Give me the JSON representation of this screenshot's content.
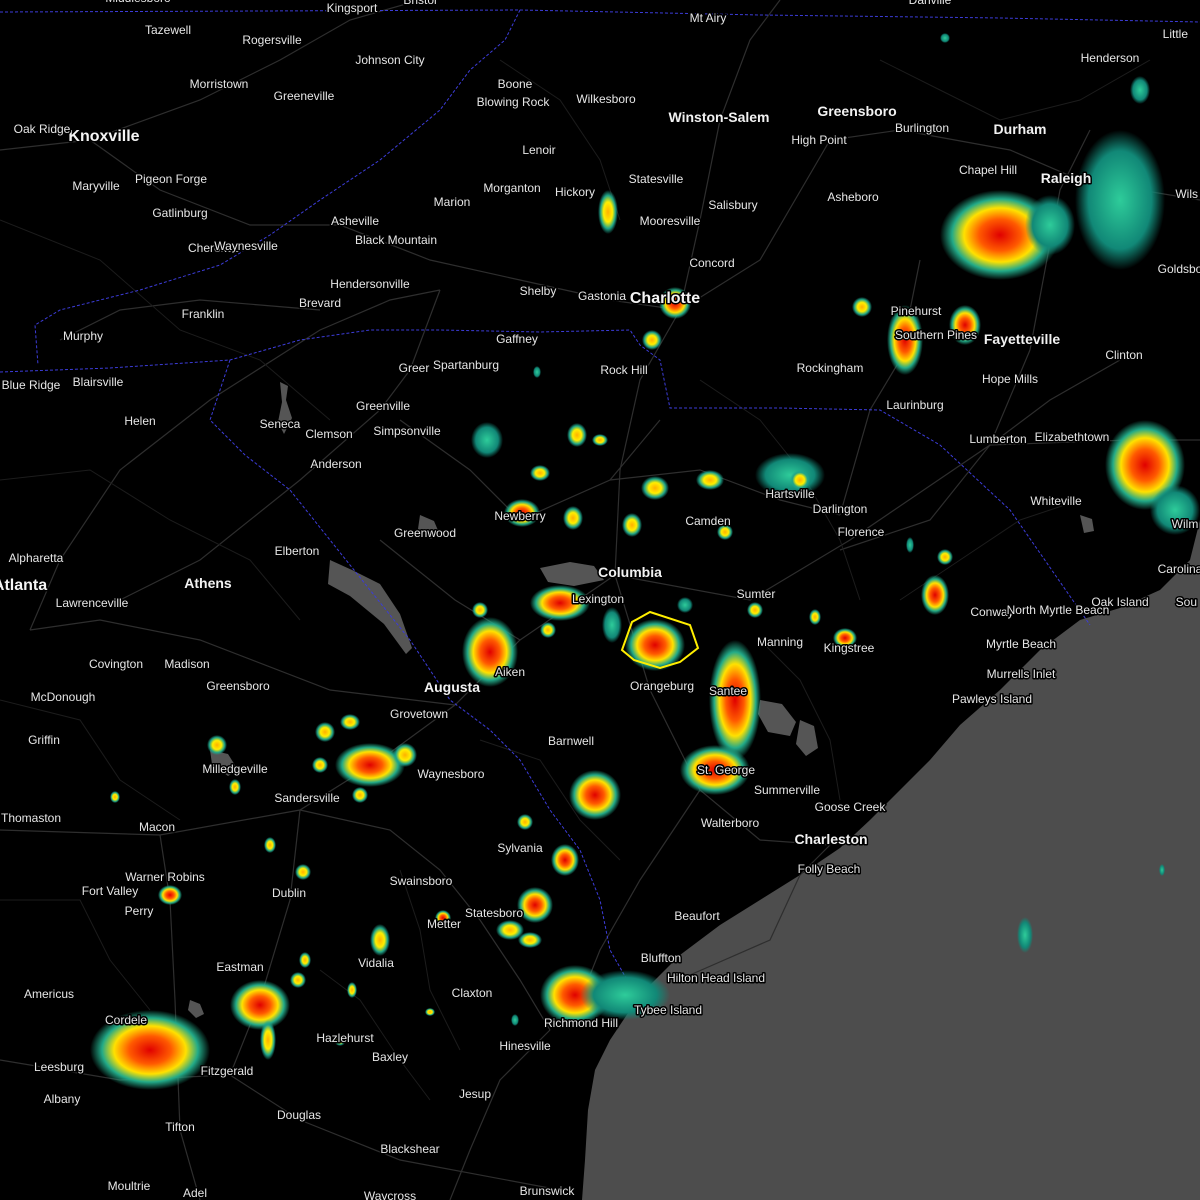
{
  "map": {
    "colors": {
      "land": "#000000",
      "ocean": "#4d4d4d",
      "roads": "#3a3a3a",
      "state_border": "#3b3bd6",
      "lakes": "#555555",
      "warning_polygon": "#ffee00",
      "radar_light": "#22aa88",
      "radar_mid": "#ffee00",
      "radar_heavy": "#ff2200"
    },
    "cities": [
      {
        "name": "Middlesboro"
      },
      {
        "name": "Kingsport"
      },
      {
        "name": "Bristol"
      },
      {
        "name": "Danville"
      },
      {
        "name": "Little"
      },
      {
        "name": "Tazewell"
      },
      {
        "name": "Rogersville"
      },
      {
        "name": "Johnson City"
      },
      {
        "name": "Mt Airy"
      },
      {
        "name": "Morristown"
      },
      {
        "name": "Greeneville"
      },
      {
        "name": "Boone"
      },
      {
        "name": "Blowing Rock"
      },
      {
        "name": "Wilkesboro"
      },
      {
        "name": "Winston-Salem"
      },
      {
        "name": "Greensboro"
      },
      {
        "name": "Burlington"
      },
      {
        "name": "Henderson"
      },
      {
        "name": "Oak Ridge"
      },
      {
        "name": "Knoxville"
      },
      {
        "name": "High Point"
      },
      {
        "name": "Durham"
      },
      {
        "name": "Lenoir"
      },
      {
        "name": "Chapel Hill"
      },
      {
        "name": "Raleigh"
      },
      {
        "name": "Wils"
      },
      {
        "name": "Maryville"
      },
      {
        "name": "Pigeon Forge"
      },
      {
        "name": "Morganton"
      },
      {
        "name": "Hickory"
      },
      {
        "name": "Statesville"
      },
      {
        "name": "Gatlinburg"
      },
      {
        "name": "Marion"
      },
      {
        "name": "Salisbury"
      },
      {
        "name": "Asheboro"
      },
      {
        "name": "Mooresville"
      },
      {
        "name": "Asheville"
      },
      {
        "name": "Cherokee"
      },
      {
        "name": "Waynesville"
      },
      {
        "name": "Black Mountain"
      },
      {
        "name": "Concord"
      },
      {
        "name": "Goldsbo"
      },
      {
        "name": "Hendersonville"
      },
      {
        "name": "Shelby"
      },
      {
        "name": "Gastonia"
      },
      {
        "name": "Charlotte"
      },
      {
        "name": "Brevard"
      },
      {
        "name": "Franklin"
      },
      {
        "name": "Pinehurst"
      },
      {
        "name": "Southern Pines"
      },
      {
        "name": "Fayetteville"
      },
      {
        "name": "Murphy"
      },
      {
        "name": "Gaffney"
      },
      {
        "name": "Clinton"
      },
      {
        "name": "Blue Ridge"
      },
      {
        "name": "Blairsville"
      },
      {
        "name": "Greer"
      },
      {
        "name": "Spartanburg"
      },
      {
        "name": "Rock Hill"
      },
      {
        "name": "Rockingham"
      },
      {
        "name": "Hope Mills"
      },
      {
        "name": "Greenville"
      },
      {
        "name": "Laurinburg"
      },
      {
        "name": "Helen"
      },
      {
        "name": "Seneca"
      },
      {
        "name": "Clemson"
      },
      {
        "name": "Simpsonville"
      },
      {
        "name": "Lumberton"
      },
      {
        "name": "Elizabethtown"
      },
      {
        "name": "Anderson"
      },
      {
        "name": "Hartsville"
      },
      {
        "name": "Newberry"
      },
      {
        "name": "Darlington"
      },
      {
        "name": "Whiteville"
      },
      {
        "name": "Wilm"
      },
      {
        "name": "Camden"
      },
      {
        "name": "Greenwood"
      },
      {
        "name": "Florence"
      },
      {
        "name": "Elberton"
      },
      {
        "name": "Alpharetta"
      },
      {
        "name": "Columbia"
      },
      {
        "name": "Carolina"
      },
      {
        "name": "Atlanta"
      },
      {
        "name": "Athens"
      },
      {
        "name": "Lexington"
      },
      {
        "name": "Sumter"
      },
      {
        "name": "Conway"
      },
      {
        "name": "North Myrtle Beach"
      },
      {
        "name": "Oak Island"
      },
      {
        "name": "Lawrenceville"
      },
      {
        "name": "Sou"
      },
      {
        "name": "Manning"
      },
      {
        "name": "Kingstree"
      },
      {
        "name": "Myrtle Beach"
      },
      {
        "name": "Covington"
      },
      {
        "name": "Madison"
      },
      {
        "name": "Aiken"
      },
      {
        "name": "Augusta"
      },
      {
        "name": "Orangeburg"
      },
      {
        "name": "Greensboro"
      },
      {
        "name": "Murrells Inlet"
      },
      {
        "name": "Santee"
      },
      {
        "name": "McDonough"
      },
      {
        "name": "Pawleys Island"
      },
      {
        "name": "Grovetown"
      },
      {
        "name": "Griffin"
      },
      {
        "name": "Barnwell"
      },
      {
        "name": "Milledgeville"
      },
      {
        "name": "Waynesboro"
      },
      {
        "name": "St. George"
      },
      {
        "name": "Summerville"
      },
      {
        "name": "Sandersville"
      },
      {
        "name": "Goose Creek"
      },
      {
        "name": "Thomaston"
      },
      {
        "name": "Walterboro"
      },
      {
        "name": "Macon"
      },
      {
        "name": "Charleston"
      },
      {
        "name": "Sylvania"
      },
      {
        "name": "Folly Beach"
      },
      {
        "name": "Warner Robins"
      },
      {
        "name": "Swainsboro"
      },
      {
        "name": "Fort Valley"
      },
      {
        "name": "Dublin"
      },
      {
        "name": "Perry"
      },
      {
        "name": "Statesboro"
      },
      {
        "name": "Beaufort"
      },
      {
        "name": "Metter"
      },
      {
        "name": "Bluffton"
      },
      {
        "name": "Hilton Head Island"
      },
      {
        "name": "Vidalia"
      },
      {
        "name": "Eastman"
      },
      {
        "name": "Claxton"
      },
      {
        "name": "Americus"
      },
      {
        "name": "Tybee Island"
      },
      {
        "name": "Cordele"
      },
      {
        "name": "Richmond Hill"
      },
      {
        "name": "Hazlehurst"
      },
      {
        "name": "Hinesville"
      },
      {
        "name": "Baxley"
      },
      {
        "name": "Leesburg"
      },
      {
        "name": "Fitzgerald"
      },
      {
        "name": "Albany"
      },
      {
        "name": "Jesup"
      },
      {
        "name": "Douglas"
      },
      {
        "name": "Tifton"
      },
      {
        "name": "Blackshear"
      },
      {
        "name": "Moultrie"
      },
      {
        "name": "Adel"
      },
      {
        "name": "Waycross"
      },
      {
        "name": "Brunswick"
      },
      {
        "name": "Oak Ridge"
      }
    ]
  }
}
